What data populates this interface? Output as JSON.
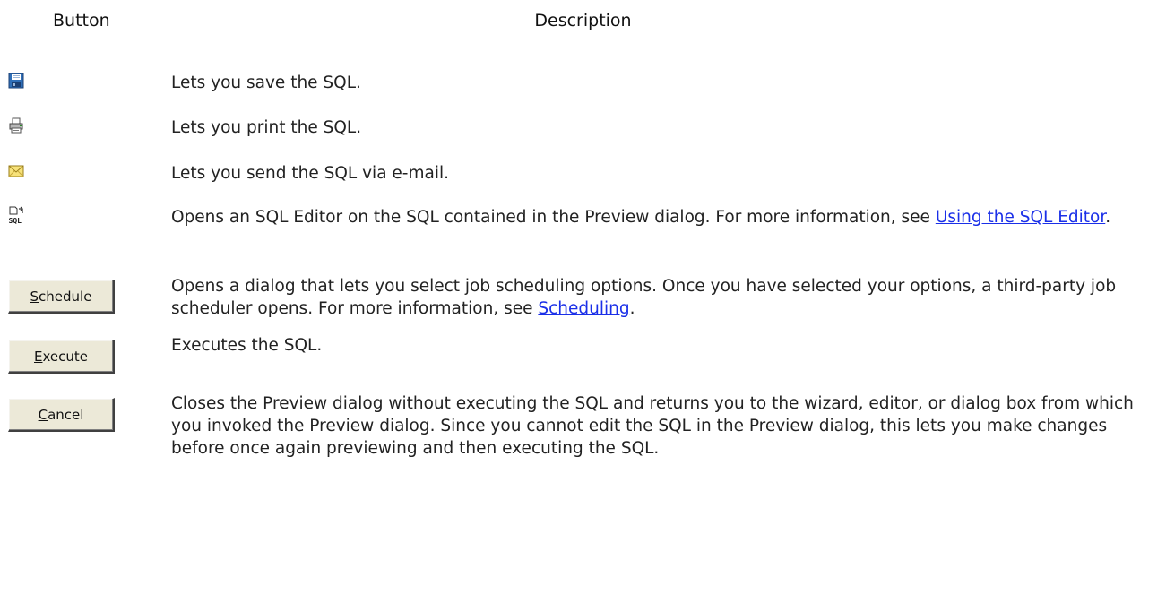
{
  "headers": {
    "button": "Button",
    "description": "Description"
  },
  "rows": [
    {
      "icon": "save-icon",
      "description": "Lets you save the SQL."
    },
    {
      "icon": "print-icon",
      "description": "Lets you print the SQL."
    },
    {
      "icon": "email-icon",
      "description": "Lets you send the SQL via e-mail."
    },
    {
      "icon": "sql-editor-icon",
      "description": "Opens an SQL Editor on the SQL contained in the Preview dialog. For more information, see ",
      "link": "Using the SQL Editor",
      "after": "."
    },
    {
      "button": {
        "mnemonic": "S",
        "rest": "chedule"
      },
      "description": "Opens a dialog that lets you select job scheduling options. Once you have selected your options, a third-party job scheduler opens. For more information, see ",
      "link": "Scheduling",
      "after": "."
    },
    {
      "button": {
        "mnemonic": "E",
        "rest": "xecute"
      },
      "description": "Executes the SQL."
    },
    {
      "button": {
        "mnemonic": "C",
        "rest": "ancel"
      },
      "description": "Closes the Preview dialog without executing the SQL and returns you to the wizard, editor, or dialog box from which you invoked the Preview dialog. Since you cannot edit the SQL in the Preview dialog, this lets you make changes before once again previewing and then executing the SQL."
    }
  ]
}
